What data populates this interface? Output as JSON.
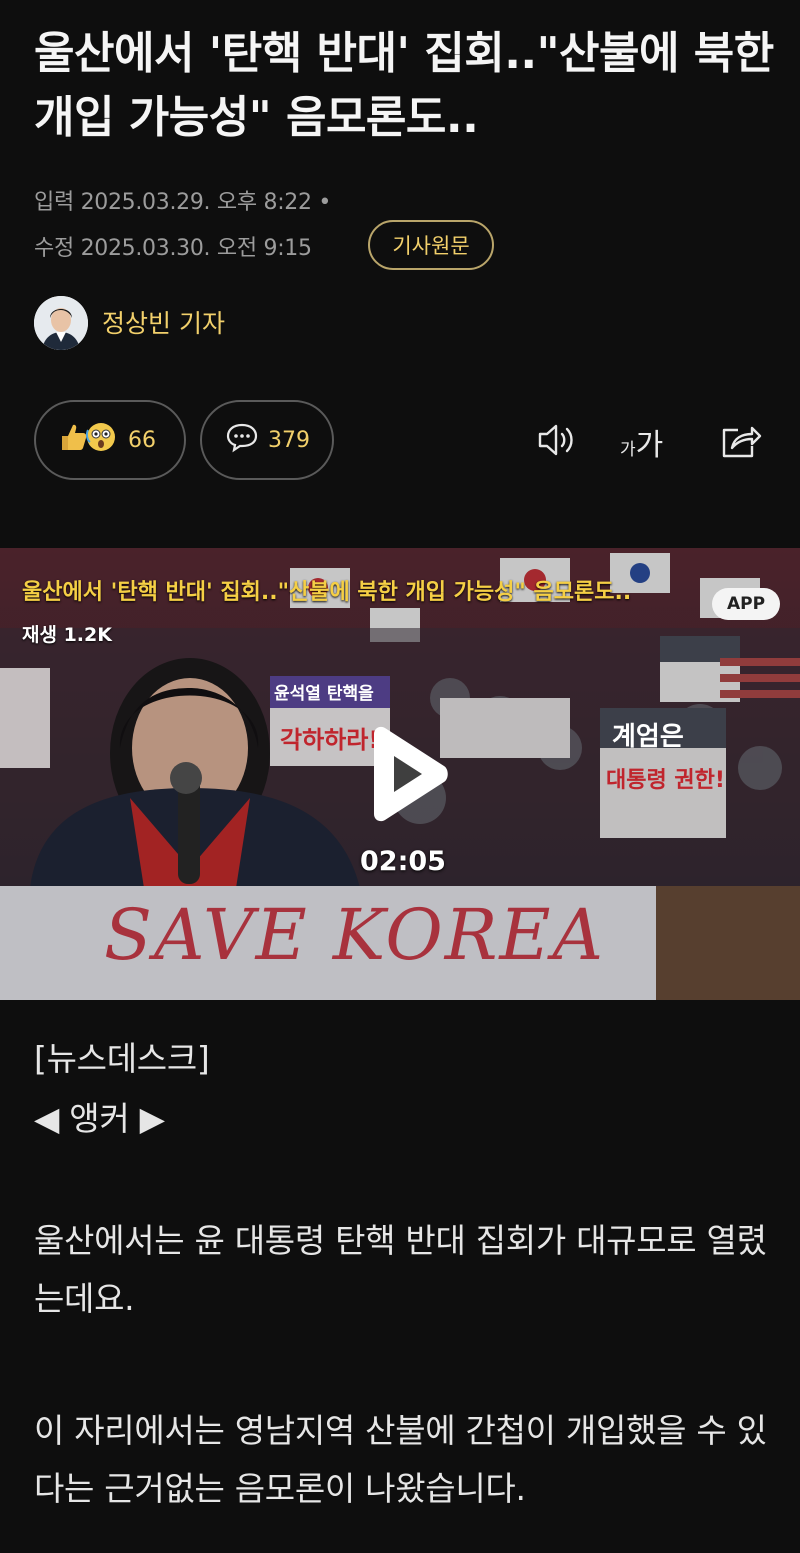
{
  "article": {
    "headline": "울산에서 '탄핵 반대' 집회..\"산불에 북한 개입 가능성\" 음모론도..",
    "input_date": "입력 2025.03.29. 오후 8:22 •",
    "modified_date": "수정 2025.03.30. 오전 9:15",
    "original_button": "기사원문",
    "reporter": "정상빈 기자"
  },
  "actions": {
    "reaction_count": "66",
    "comment_count": "379",
    "font_size_label_small": "가",
    "font_size_label_large": "가"
  },
  "video": {
    "title": "울산에서 '탄핵 반대' 집회..\"산불에 북한 개입 가능성\" 음모론도..",
    "views": "재생 1.2K",
    "app_badge": "APP",
    "duration": "02:05",
    "banner_text": "SAVE KOREA",
    "signs": [
      "계엄은",
      "대통령 권한!",
      "윤석열 탄핵을",
      "각하하라!"
    ]
  },
  "body": {
    "tag1": "[뉴스데스크]",
    "tag2": "◀ 앵커 ▶",
    "paragraphs": [
      "울산에서는 윤 대통령 탄핵 반대 집회가 대규모로 열렸는데요.",
      "이 자리에서는 영남지역 산불에 간첩이 개입했을 수 있다는 근거없는 음모론이 나왔습니다."
    ]
  },
  "colors": {
    "background": "#0e0e0e",
    "accent": "#f2d06b",
    "muted": "#9c9c9c"
  },
  "icons": [
    "thumbs-up-icon",
    "shocked-face-icon",
    "comment-icon",
    "speaker-icon",
    "font-size-icon",
    "share-icon",
    "play-icon"
  ]
}
